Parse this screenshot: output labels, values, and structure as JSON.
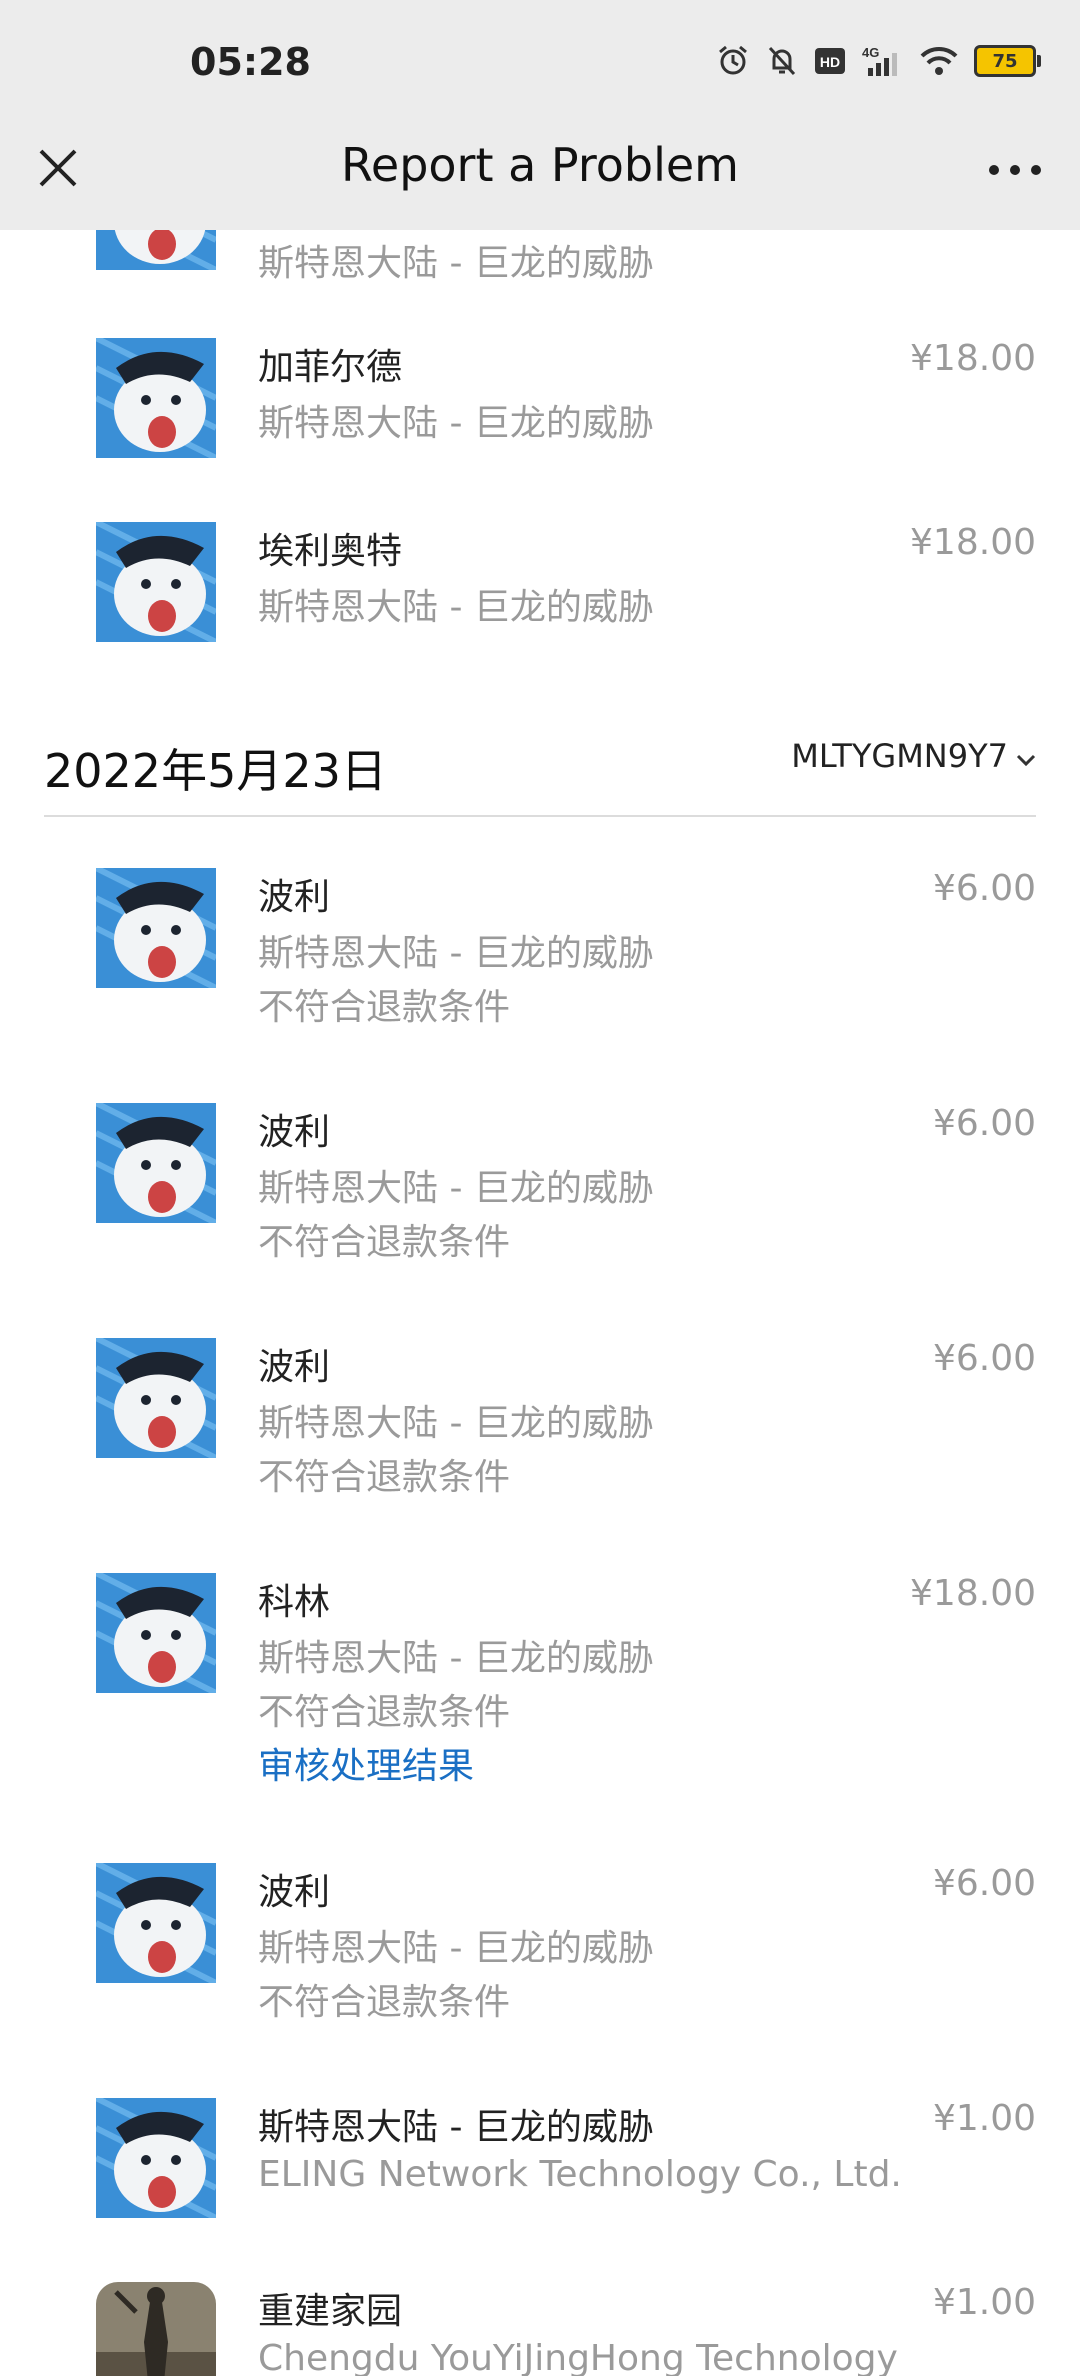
{
  "status_bar": {
    "time": "05:28",
    "battery": "75",
    "icons": [
      "alarm-icon",
      "mute-bell-icon",
      "hd-icon",
      "signal-4g-icon",
      "wifi-icon",
      "battery-icon"
    ],
    "hd_label": "HD",
    "network_label": "4G"
  },
  "header": {
    "title": "Report a Problem",
    "close_icon": "close-icon",
    "more_icon": "more-icon"
  },
  "colors": {
    "link": "#1a6fc4",
    "muted": "#9a9a9a",
    "battery": "#f5c400"
  },
  "top_items": [
    {
      "name": "",
      "app": "斯特恩大陆 - 巨龙的威胁",
      "price": ""
    },
    {
      "name": "加菲尔德",
      "app": "斯特恩大陆 - 巨龙的威胁",
      "price": "¥18.00"
    },
    {
      "name": "埃利奥特",
      "app": "斯特恩大陆 - 巨龙的威胁",
      "price": "¥18.00"
    }
  ],
  "group": {
    "date": "2022年5月23日",
    "order_id": "MLTYGMN9Y7",
    "items": [
      {
        "name": "波利",
        "app": "斯特恩大陆 - 巨龙的威胁",
        "status": "不符合退款条件",
        "price": "¥6.00"
      },
      {
        "name": "波利",
        "app": "斯特恩大陆 - 巨龙的威胁",
        "status": "不符合退款条件",
        "price": "¥6.00"
      },
      {
        "name": "波利",
        "app": "斯特恩大陆 - 巨龙的威胁",
        "status": "不符合退款条件",
        "price": "¥6.00"
      },
      {
        "name": "科林",
        "app": "斯特恩大陆 - 巨龙的威胁",
        "status": "不符合退款条件",
        "link": "审核处理结果",
        "price": "¥18.00"
      },
      {
        "name": "波利",
        "app": "斯特恩大陆 - 巨龙的威胁",
        "status": "不符合退款条件",
        "price": "¥6.00"
      },
      {
        "name": "斯特恩大陆 - 巨龙的威胁",
        "app": "ELING Network Technology Co., Ltd.",
        "price": "¥1.00"
      },
      {
        "name": "重建家园",
        "app": "Chengdu YouYiJingHong Technology",
        "price": "¥1.00"
      }
    ]
  }
}
